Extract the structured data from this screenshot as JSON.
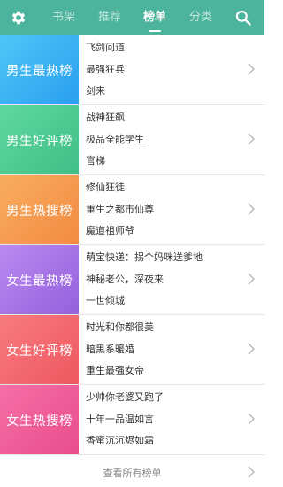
{
  "colors": {
    "topbar": "#4cb49d",
    "banners": [
      "#33b0f2",
      "#4cc990",
      "#f59a4f",
      "#a875e6",
      "#f2686e",
      "#ee5e98"
    ]
  },
  "header": {
    "settings_icon": "gear-icon",
    "search_icon": "search-icon",
    "tabs": [
      {
        "label": "书架",
        "active": false
      },
      {
        "label": "推荐",
        "active": false
      },
      {
        "label": "榜单",
        "active": true
      },
      {
        "label": "分类",
        "active": false
      }
    ]
  },
  "rankings": [
    {
      "title": "男生最热榜",
      "books": [
        "飞剑问道",
        "最强狂兵",
        "剑来"
      ]
    },
    {
      "title": "男生好评榜",
      "books": [
        "战神狂飙",
        "极品全能学生",
        "官梯"
      ]
    },
    {
      "title": "男生热搜榜",
      "books": [
        "修仙狂徒",
        "重生之都市仙尊",
        "魔道祖师爷"
      ]
    },
    {
      "title": "女生最热榜",
      "books": [
        "萌宝快递：拐个妈咪送爹地",
        "神秘老公，深夜来",
        "一世倾城"
      ]
    },
    {
      "title": "女生好评榜",
      "books": [
        "时光和你都很美",
        "暗黑系暖婚",
        "重生最强女帝"
      ]
    },
    {
      "title": "女生热搜榜",
      "books": [
        "少帅你老婆又跑了",
        "十年一品温如言",
        "香蜜沉沉烬如霜"
      ]
    }
  ],
  "footer": {
    "label": "查看所有榜单",
    "icon": "chevron-right-icon"
  }
}
